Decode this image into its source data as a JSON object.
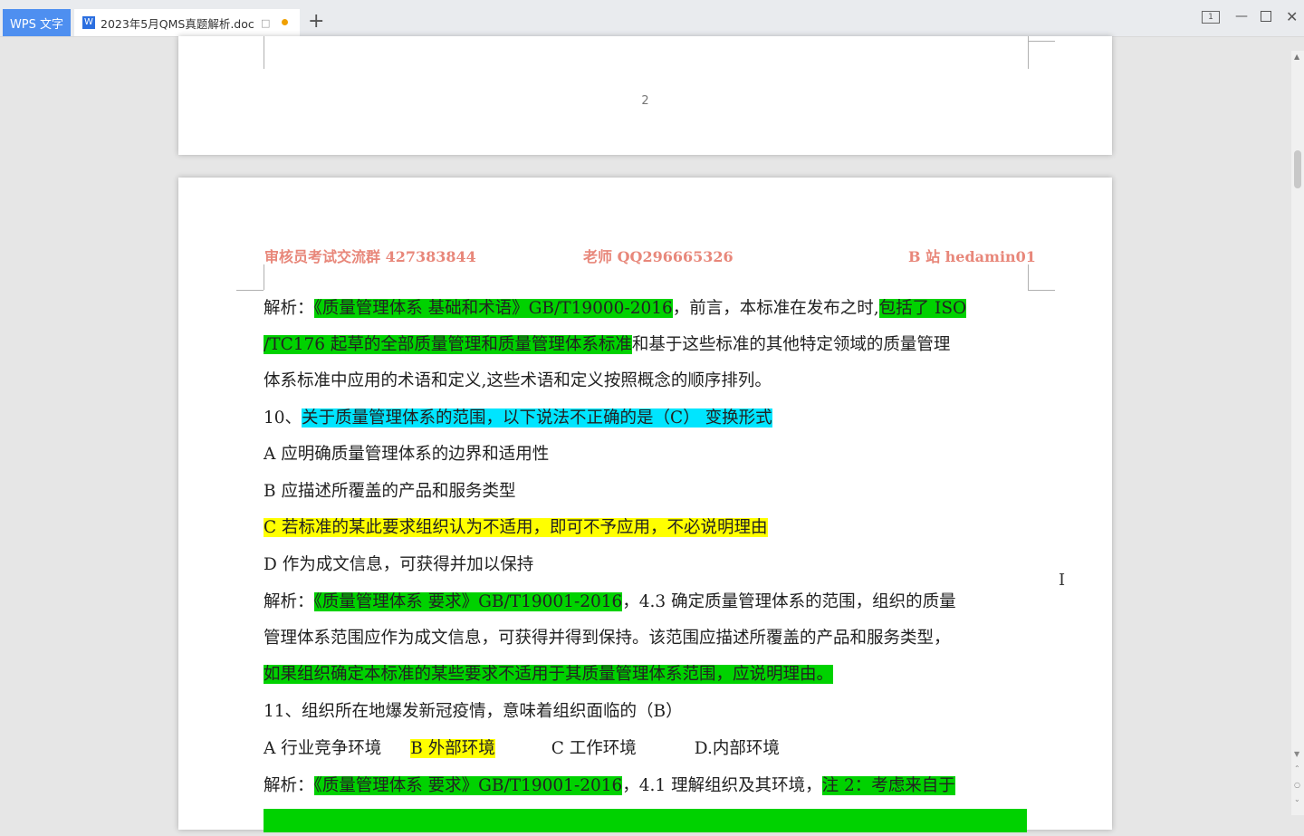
{
  "app": {
    "name": "WPS 文字",
    "tab_title": "2023年5月QMS真题解析.doc",
    "tab_icon": "W",
    "new_tab": "+",
    "layout_icon_text": "1"
  },
  "page_top": {
    "page_number": "2"
  },
  "header": {
    "left": "审核员考试交流群 427383844",
    "center": "老师 QQ296665326",
    "right": "B 站 hedamin01"
  },
  "body": {
    "l1_a": "解析：",
    "l1_b": "《质量管理体系 基础和术语》GB/T19000-2016",
    "l1_c": "，前言，本标准在发布之时,",
    "l1_d": "包括了 ISO",
    "l2_a": "/TC176 起草的全部质量管理和质量管理体系标准",
    "l2_b": "和基于这些标准的其他特定领域的质量管理",
    "l3": "体系标准中应用的术语和定义,这些术语和定义按照概念的顺序排列。",
    "q10_num": "10、",
    "q10_text": "关于质量管理体系的范围，以下说法不正确的是（C）            变换形式",
    "q10_a": "A 应明确质量管理体系的边界和适用性",
    "q10_b": "B 应描述所覆盖的产品和服务类型",
    "q10_c": "C 若标准的某此要求组织认为不适用，即可不予应用，不必说明理由",
    "q10_d": "D 作为成文信息，可获得并加以保持",
    "a10_a": "解析：",
    "a10_b": "《质量管理体系 要求》GB/T19001-2016",
    "a10_c": "，4.3 确定质量管理体系的范围，组织的质量",
    "a10_l2": "管理体系范围应作为成文信息，可获得并得到保持。该范围应描述所覆盖的产品和服务类型，",
    "a10_l3": "如果组织确定本标准的某些要求不适用于其质量管理体系范围，应说明理由。",
    "q11": "11、组织所在地爆发新冠疫情，意味着组织面临的（B）",
    "q11_a": "A 行业竞争环境",
    "q11_b": "B 外部环境",
    "q11_c": "C 工作环境",
    "q11_d": "D.内部环境",
    "a11_a": "解析：",
    "a11_b": "《质量管理体系 要求》GB/T19001-2016",
    "a11_c": "，4.1  理解组织及其环境，",
    "a11_d": "注 2：考虑来自于"
  },
  "colors": {
    "highlight_green": "#00d200",
    "highlight_yellow": "#ffff00",
    "highlight_cyan": "#00e5ff",
    "header_text": "#e8877a",
    "wps_button": "#4e8ff0"
  }
}
